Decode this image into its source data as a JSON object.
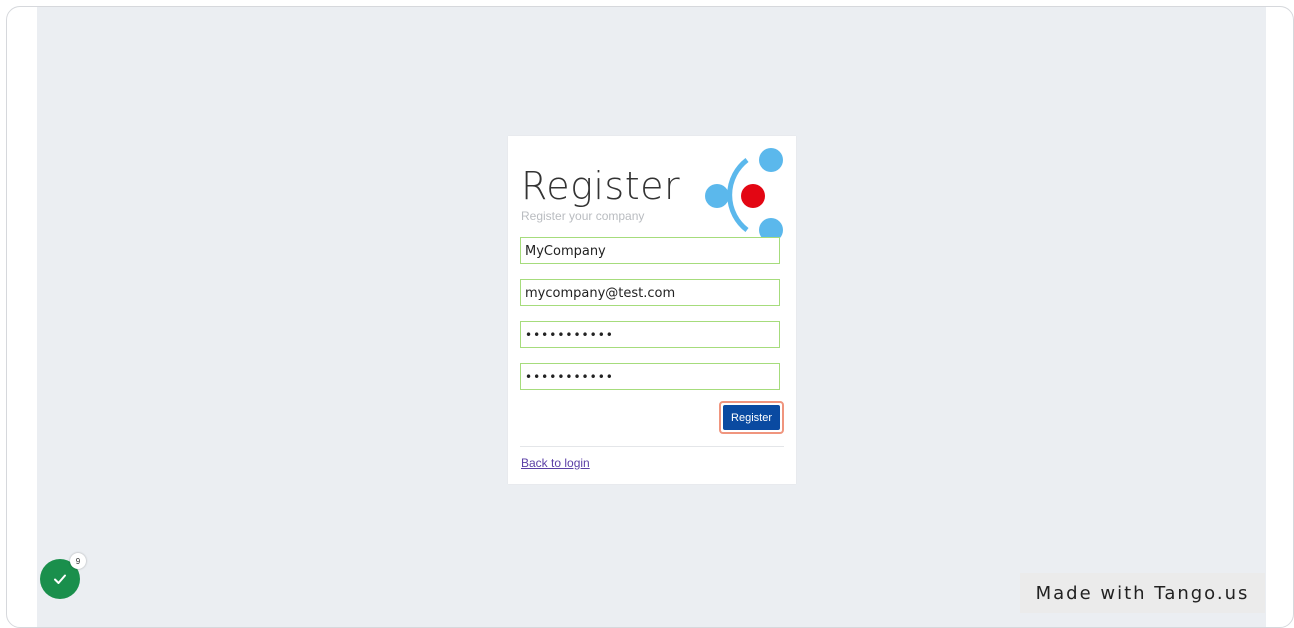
{
  "register": {
    "title": "Register",
    "subtitle": "Register your company",
    "fields": {
      "company": "MyCompany",
      "email": "mycompany@test.com",
      "password": "•••••••••••",
      "confirm_password": "•••••••••••"
    },
    "submit_label": "Register",
    "back_link": "Back to login"
  },
  "logo": {
    "icon": "company-logo",
    "colors": {
      "arc": "#5bb8ec",
      "dot": "#e30613"
    }
  },
  "overlay": {
    "check_count": "9",
    "watermark": "Made with Tango.us",
    "highlight_color": "#f0957e"
  },
  "colors": {
    "page_bg": "#ebeef2",
    "field_border": "#a6dc7c",
    "button_bg": "#0a4aa1",
    "link": "#5b3fa6",
    "badge": "#1a8f4c"
  }
}
